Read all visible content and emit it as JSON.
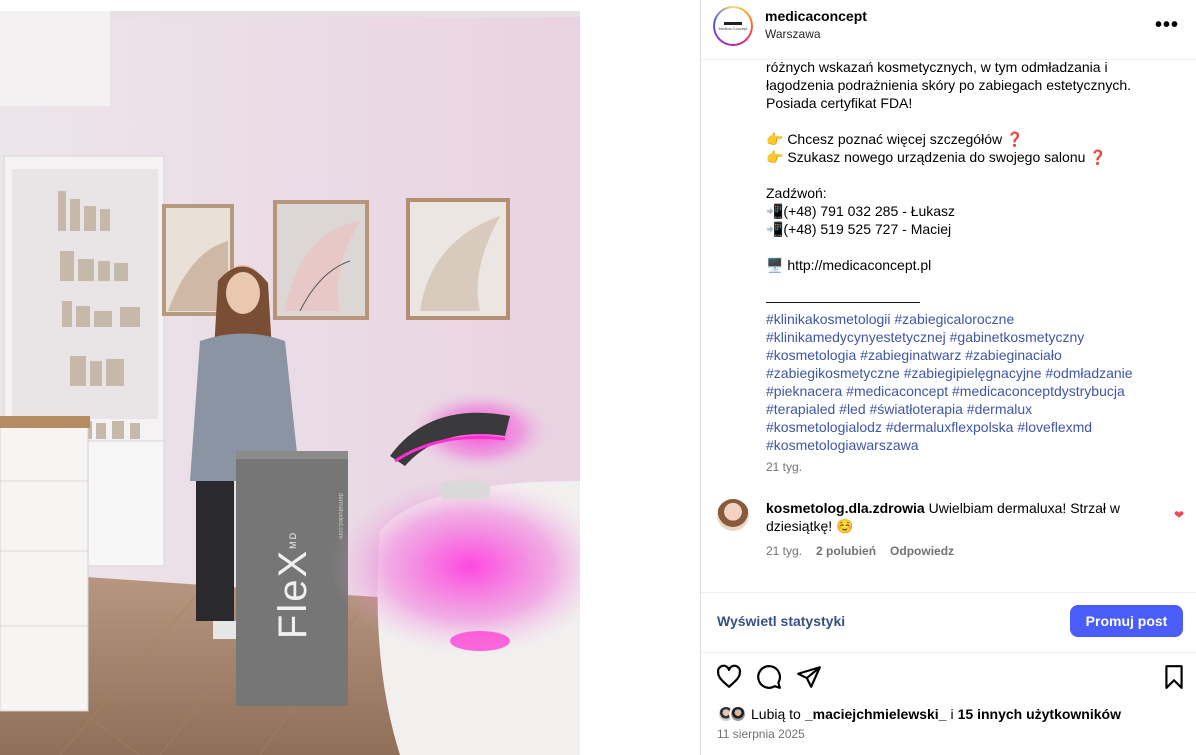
{
  "post": {
    "username": "medicaconcept",
    "location": "Warszawa",
    "avatar_text": "Medica Concept",
    "more_label": "•••"
  },
  "caption": {
    "lines": [
      "różnych wskazań kosmetycznych, w tym odmładzania i",
      "łagodzenia podrażnienia skóry po zabiegach estetycznych.",
      "Posiada certyfikat FDA!",
      "",
      "👉 Chcesz poznać więcej szczegółów ❓",
      "👉 Szukasz nowego urządzenia do swojego salonu ❓",
      "",
      "Zadźwoń:",
      "📲(+48) 791 032 285 - Łukasz",
      "📲(+48) 519 525 727 - Maciej",
      "",
      "🖥️ http://medicaconcept.pl",
      "",
      "———————————"
    ],
    "hashtags": [
      "#klinikakosmetologii #zabiegicaloroczne",
      "#klinikamedycynyestetycznej #gabinetkosmetyczny",
      "#kosmetologia #zabieginatwarz #zabieginaciało",
      "#zabiegikosmetyczne #zabiegipielęgnacyjne #odmładzanie",
      "#pieknacera #medicaconcept #medicaconceptdystrybucja",
      "#terapialed #led #światłoterapia #dermalux",
      "#kosmetologialodz #dermaluxflexpolska #loveflexmd",
      "#kosmetologiawarszawa"
    ],
    "time": "21 tyg."
  },
  "comment": {
    "username": "kosmetolog.dla.zdrowia",
    "text": "Uwielbiam dermaluxa! Strzał w dziesiątkę! ☺️",
    "time": "21 tyg.",
    "likes": "2 polubień",
    "reply": "Odpowiedz"
  },
  "stats": {
    "link": "Wyświetl statystyki",
    "promote": "Promuj post"
  },
  "likes": {
    "prefix": "Lubią to",
    "user": "_maciejchmielewski_",
    "middle": "i",
    "others": "15 innych użytkowników"
  },
  "date": "11 sierpnia 2025",
  "photo": {
    "device_brand": "FleX",
    "device_sup": "MD",
    "device_site": "dermaluxled.com"
  },
  "colors": {
    "accent": "#4a5df9",
    "link": "#385185",
    "hashtag": "#3f56a6",
    "led_pink": "#ff2fd1"
  }
}
